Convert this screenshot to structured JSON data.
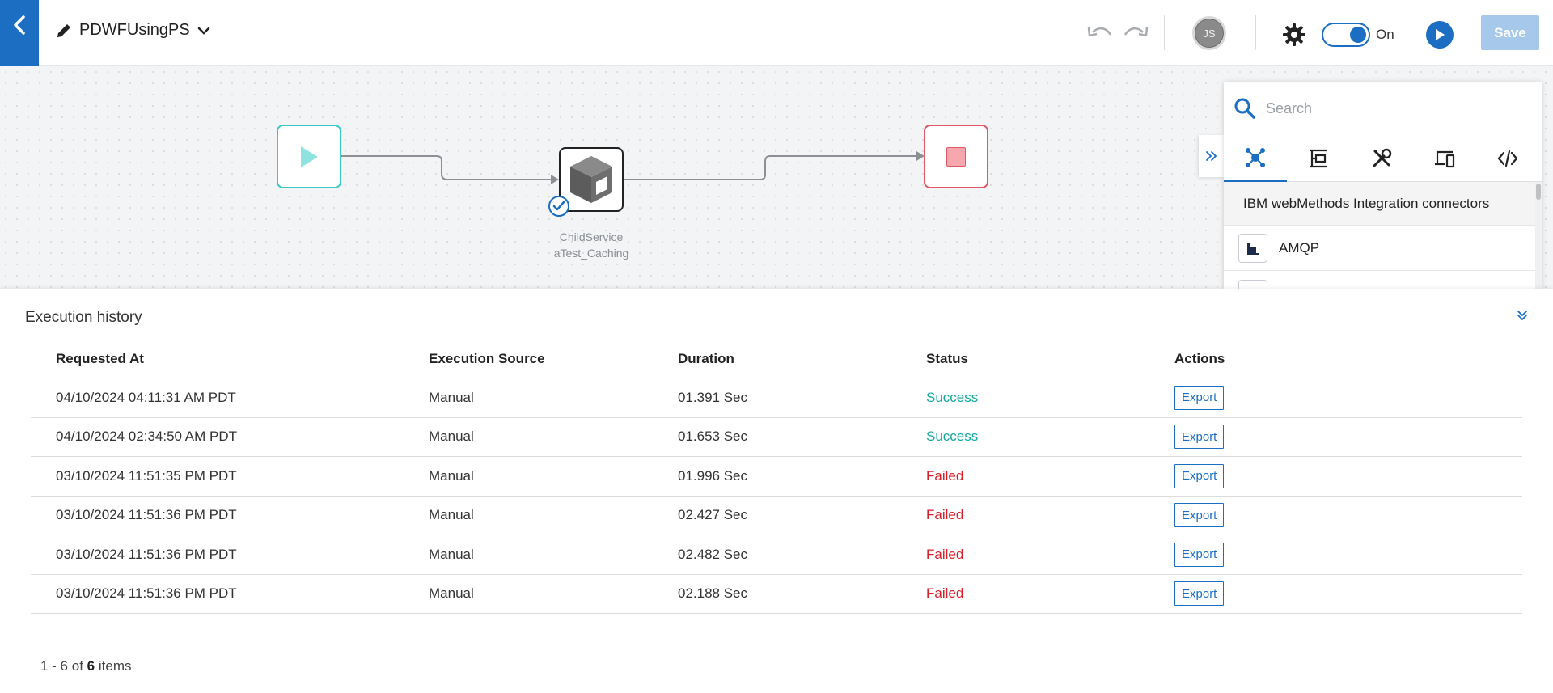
{
  "header": {
    "workflow_name": "PDWFUsingPS",
    "user_initials": "JS",
    "toggle_label": "On",
    "save_label": "Save"
  },
  "canvas": {
    "service_node_label_line1": "ChildService",
    "service_node_label_line2": "aTest_Caching"
  },
  "panel": {
    "search_placeholder": "Search",
    "section_title": "IBM webMethods Integration connectors",
    "connectors": [
      "AMQP"
    ],
    "tabs": [
      "connectors-icon",
      "flow-services-icon",
      "tools-icon",
      "devices-icon",
      "code-icon"
    ]
  },
  "history": {
    "title": "Execution history",
    "columns": [
      "Requested At",
      "Execution Source",
      "Duration",
      "Status",
      "Actions"
    ],
    "rows": [
      {
        "requested_at": "04/10/2024 04:11:31 AM PDT",
        "source": "Manual",
        "duration": "01.391 Sec",
        "status": "Success",
        "action": "Export"
      },
      {
        "requested_at": "04/10/2024 02:34:50 AM PDT",
        "source": "Manual",
        "duration": "01.653 Sec",
        "status": "Success",
        "action": "Export"
      },
      {
        "requested_at": "03/10/2024 11:51:35 PM PDT",
        "source": "Manual",
        "duration": "01.996 Sec",
        "status": "Failed",
        "action": "Export"
      },
      {
        "requested_at": "03/10/2024 11:51:36 PM PDT",
        "source": "Manual",
        "duration": "02.427 Sec",
        "status": "Failed",
        "action": "Export"
      },
      {
        "requested_at": "03/10/2024 11:51:36 PM PDT",
        "source": "Manual",
        "duration": "02.482 Sec",
        "status": "Failed",
        "action": "Export"
      },
      {
        "requested_at": "03/10/2024 11:51:36 PM PDT",
        "source": "Manual",
        "duration": "02.188 Sec",
        "status": "Failed",
        "action": "Export"
      }
    ],
    "pager_range": "1 - 6 of",
    "pager_total": "6",
    "pager_suffix": "items"
  },
  "colors": {
    "accent": "#1b6ec2",
    "success": "#14a89f",
    "failed": "#da1e28",
    "start_node": "#39c9c6",
    "end_node": "#e05865"
  }
}
